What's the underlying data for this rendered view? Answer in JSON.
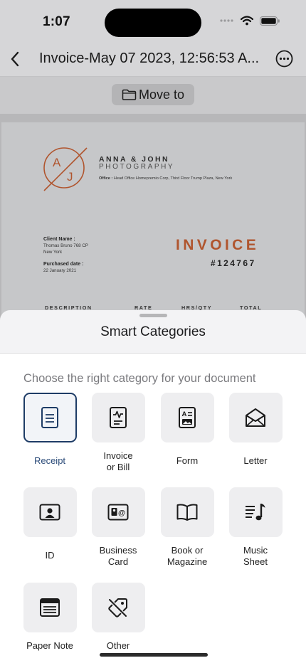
{
  "status_bar": {
    "time": "1:07"
  },
  "nav": {
    "title": "Invoice-May 07 2023, 12:56:53 A...",
    "back_icon": "chevron-left-icon",
    "more_icon": "ellipsis-circle-icon"
  },
  "toolbar": {
    "move_label": "Move to",
    "move_icon": "folder-icon"
  },
  "document": {
    "logo_letters": [
      "A",
      "J"
    ],
    "studio_name": "ANNA & JOHN",
    "studio_sub": "PHOTOGRAPHY",
    "office_label": "Office :",
    "office_address": "Head Office Homepremio Corp, Third Floor Trump Plaza, New York",
    "client_label": "Client Name :",
    "client_value": "Thomas Bruno 768 CP New York",
    "purchased_label": "Purchased date :",
    "purchased_value": "22 January 2021",
    "invoice_word": "INVOICE",
    "invoice_number": "#124767",
    "columns": [
      "DESCRIPTION",
      "RATE",
      "HRS/QTY",
      "TOTAL"
    ]
  },
  "sheet": {
    "title": "Smart Categories",
    "subtitle": "Choose the right category for your document",
    "categories": [
      {
        "label": "Receipt",
        "icon": "receipt-icon",
        "selected": true
      },
      {
        "label": "Invoice\nor Bill",
        "icon": "invoice-icon",
        "selected": false
      },
      {
        "label": "Form",
        "icon": "form-icon",
        "selected": false
      },
      {
        "label": "Letter",
        "icon": "envelope-icon",
        "selected": false
      },
      {
        "label": "ID",
        "icon": "id-card-icon",
        "selected": false
      },
      {
        "label": "Business\nCard",
        "icon": "business-card-icon",
        "selected": false
      },
      {
        "label": "Book or\nMagazine",
        "icon": "book-icon",
        "selected": false
      },
      {
        "label": "Music\nSheet",
        "icon": "music-sheet-icon",
        "selected": false
      },
      {
        "label": "Paper Note",
        "icon": "paper-note-icon",
        "selected": false
      },
      {
        "label": "Other",
        "icon": "tag-off-icon",
        "selected": false
      }
    ]
  },
  "colors": {
    "selected_accent": "#1e3c66",
    "invoice_accent": "#b0552e"
  }
}
